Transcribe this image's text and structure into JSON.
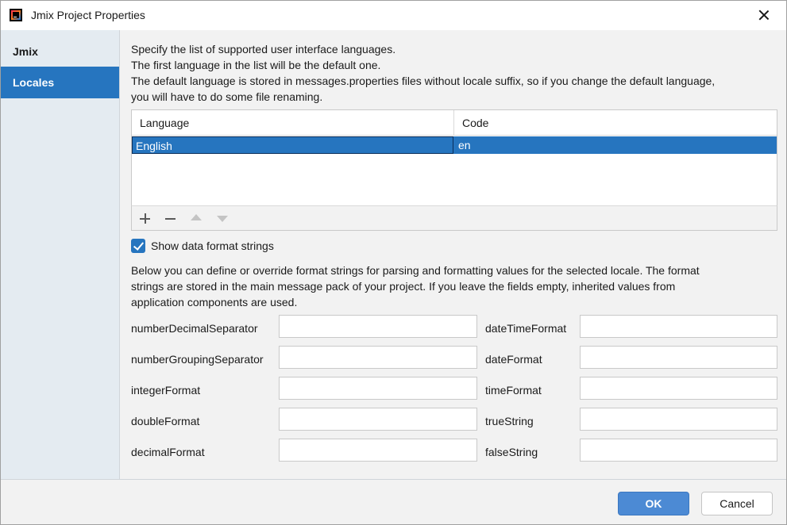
{
  "window": {
    "title": "Jmix Project Properties",
    "app_icon": "intellij-idea-icon",
    "close_icon": "close-icon"
  },
  "sidebar": {
    "items": [
      {
        "label": "Jmix",
        "selected": false
      },
      {
        "label": "Locales",
        "selected": true
      }
    ]
  },
  "locales": {
    "description": [
      "Specify the list of supported user interface languages.",
      "The first language in the list will be the default one.",
      "The default language is stored in messages.properties files without locale suffix, so if you change the default language,",
      "you will have to do some file renaming."
    ],
    "table": {
      "columns": [
        "Language",
        "Code"
      ],
      "rows": [
        {
          "language": "English",
          "code": "en",
          "selected": true
        }
      ]
    },
    "toolbar": {
      "add_icon": "plus-icon",
      "remove_icon": "minus-icon",
      "move_up_icon": "arrow-up-icon",
      "move_down_icon": "arrow-down-icon"
    },
    "show_format_strings": {
      "label": "Show data format strings",
      "checked": true
    },
    "format_description": [
      "Below you can define or override format strings for parsing and formatting values for the selected locale. The format",
      "strings are stored in the main message pack of your project. If you leave the fields empty, inherited values from",
      "application components are used."
    ],
    "fields_left": [
      {
        "label": "numberDecimalSeparator",
        "value": ""
      },
      {
        "label": "numberGroupingSeparator",
        "value": ""
      },
      {
        "label": "integerFormat",
        "value": ""
      },
      {
        "label": "doubleFormat",
        "value": ""
      },
      {
        "label": "decimalFormat",
        "value": ""
      }
    ],
    "fields_right": [
      {
        "label": "dateTimeFormat",
        "value": ""
      },
      {
        "label": "dateFormat",
        "value": ""
      },
      {
        "label": "timeFormat",
        "value": ""
      },
      {
        "label": "trueString",
        "value": ""
      },
      {
        "label": "falseString",
        "value": ""
      }
    ]
  },
  "footer": {
    "ok_label": "OK",
    "cancel_label": "Cancel"
  },
  "colors": {
    "accent": "#2675bf",
    "ok_button": "#4c8ad4",
    "sidebar_bg": "#e4ebf1"
  }
}
